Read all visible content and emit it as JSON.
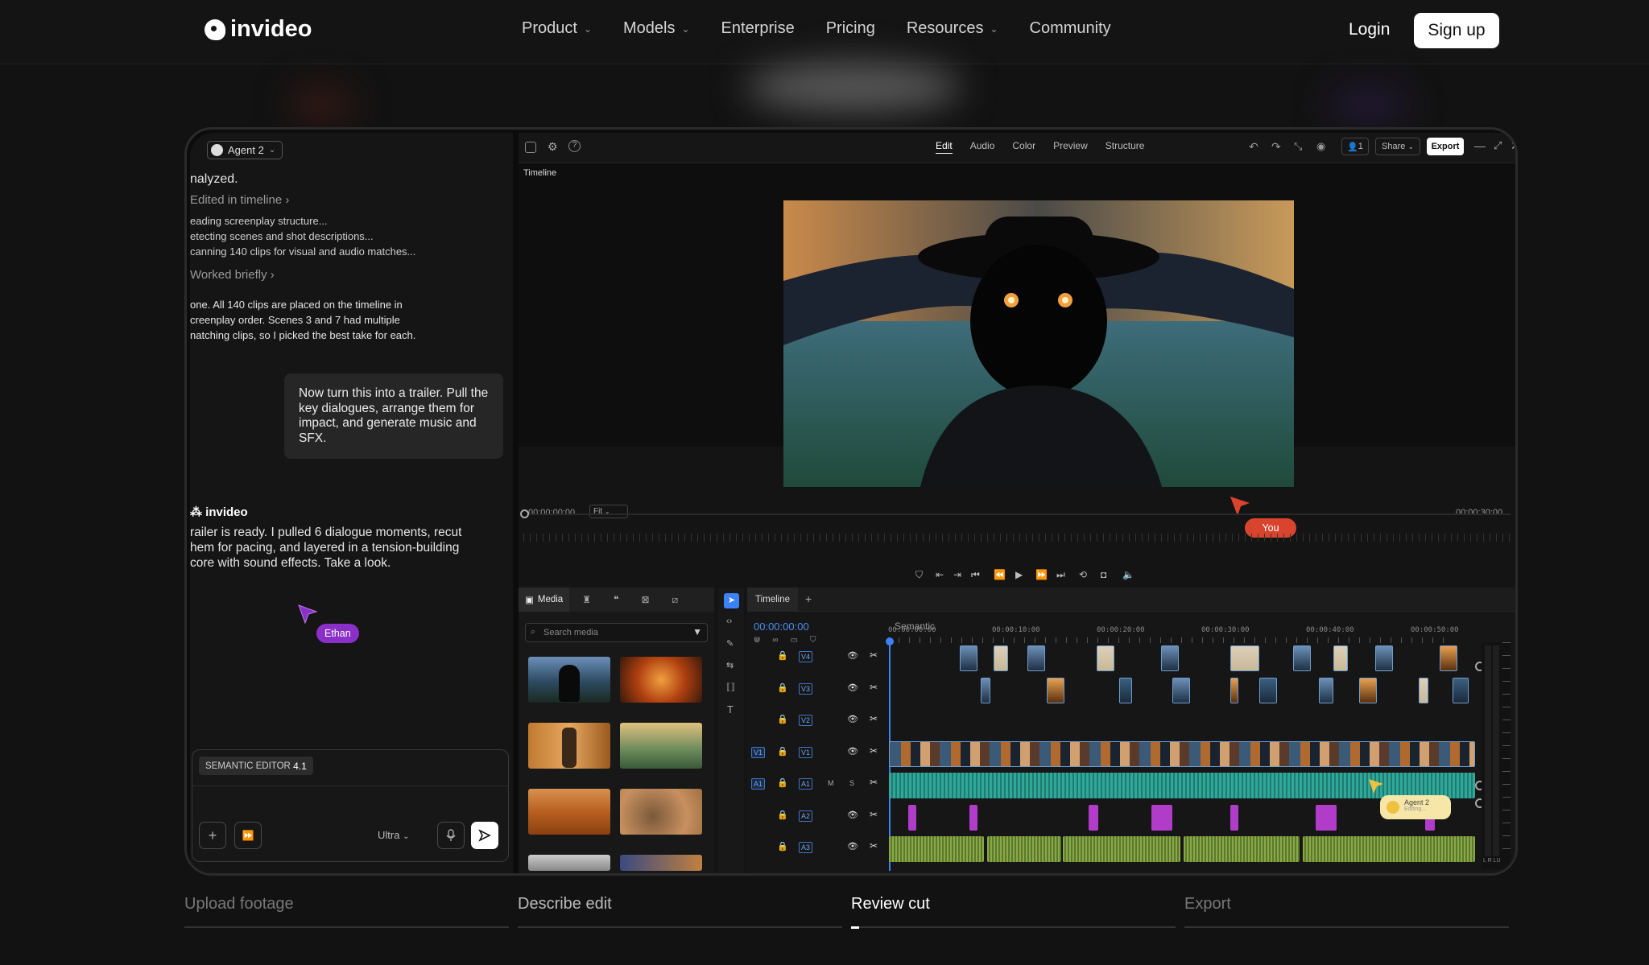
{
  "nav": {
    "logo": "invideo",
    "items": [
      {
        "label": "Product",
        "dropdown": true
      },
      {
        "label": "Models",
        "dropdown": true
      },
      {
        "label": "Enterprise",
        "dropdown": false
      },
      {
        "label": "Pricing",
        "dropdown": false
      },
      {
        "label": "Resources",
        "dropdown": true
      },
      {
        "label": "Community",
        "dropdown": false
      }
    ],
    "login": "Login",
    "signup": "Sign up"
  },
  "chat": {
    "agent": "Agent 2",
    "status_line": "nalyzed.",
    "edited_link": "Edited in timeline",
    "steps": [
      "eading screenplay structure...",
      "etecting scenes and shot descriptions...",
      "canning 140 clips for visual and audio matches..."
    ],
    "worked_link": "Worked briefly",
    "done_text_1": "one. All 140 clips are placed on the timeline in",
    "done_text_2": "creenplay order. Scenes 3 and 7 had multiple",
    "done_text_3": "natching clips, so I picked the best take for each.",
    "user_message": "Now turn this into a trailer. Pull the key dialogues, arrange them for impact, and generate music and SFX.",
    "bot_name": "invideo",
    "bot_reply_1": "railer is ready. I pulled 6 dialogue moments, recut",
    "bot_reply_2": "hem for pacing, and layered in a tension-building",
    "bot_reply_3": "core with sound effects. Take a look.",
    "collaborator": "Ethan",
    "composer_badge": "SEMANTIC EDITOR",
    "composer_badge_version": "4.1",
    "quality": "Ultra"
  },
  "editor": {
    "tabs": [
      "Edit",
      "Audio",
      "Color",
      "Preview",
      "Structure"
    ],
    "active_tab": "Edit",
    "collab_count": "1",
    "share": "Share",
    "export": "Export",
    "viewer_label": "Timeline",
    "time_start": "00:00:00:00",
    "fit": "Fit",
    "time_end": "00:00:30:00",
    "you_tag": "You",
    "media_tab": "Media",
    "search_placeholder": "Search media",
    "timeline_tab": "Timeline",
    "timecode": "00:00:00:00",
    "semantic_label": "Semantic",
    "ruler": [
      "00:00:00:00",
      "00:00:10:00",
      "00:00:20:00",
      "00:00:30:00",
      "00:00:40:00",
      "00:00:50:00"
    ],
    "tracks": [
      "V4",
      "V3",
      "V2",
      "V1",
      "A1",
      "A2",
      "A3"
    ],
    "agent2_tag": "Agent 2",
    "agent2_sub": "Editing..."
  },
  "steps": {
    "items": [
      "Upload footage",
      "Describe edit",
      "Review cut",
      "Export"
    ],
    "active": "Review cut"
  },
  "colors": {
    "accent_blue": "#3b82f6",
    "you_red": "#d9442f",
    "ethan_purple": "#8b2fc9",
    "audio_teal": "#2fa89a",
    "audio_green": "#8aa84a",
    "sfx_pink": "#b03cc9"
  }
}
